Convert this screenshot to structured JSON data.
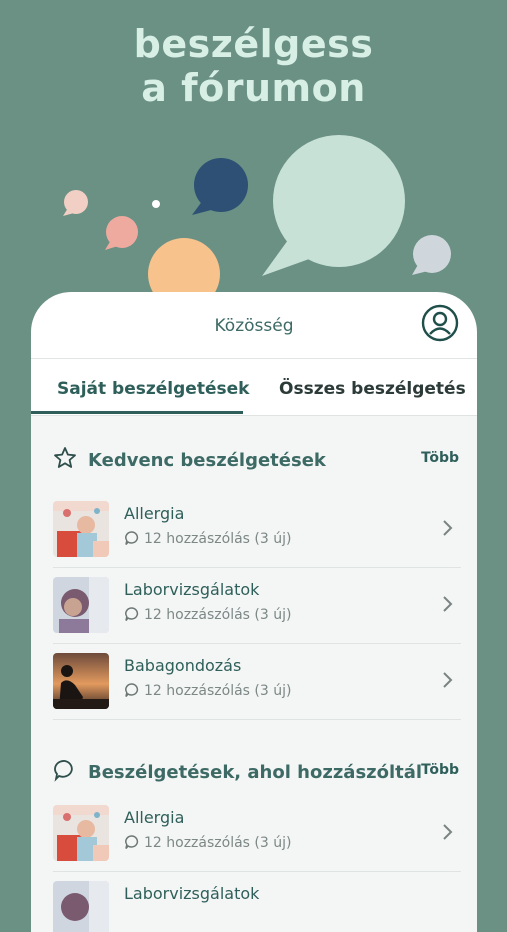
{
  "headline": {
    "line1": "beszélgess",
    "line2": "a fórumon"
  },
  "app": {
    "title": "Közösség"
  },
  "tabs": [
    {
      "label": "Saját beszélgetések",
      "active": true
    },
    {
      "label": "Összes beszélgetés",
      "active": false
    }
  ],
  "sections": [
    {
      "title": "Kedvenc beszélgetések",
      "more": "Több",
      "icon": "star-icon",
      "items": [
        {
          "title": "Allergia",
          "meta": "12 hozzászólás (3 új)"
        },
        {
          "title": "Laborvizsgálatok",
          "meta": "12 hozzászólás (3 új)"
        },
        {
          "title": "Babagondozás",
          "meta": "12 hozzászólás (3 új)"
        }
      ]
    },
    {
      "title": "Beszélgetések, ahol hozzászóltál",
      "more": "Több",
      "icon": "comment-icon",
      "items": [
        {
          "title": "Allergia",
          "meta": "12 hozzászólás (3 új)"
        },
        {
          "title": "Laborvizsgálatok",
          "meta": ""
        }
      ]
    }
  ],
  "colors": {
    "background": "#6a9184",
    "accent": "#2f5f5a",
    "headline": "#d8efe6"
  }
}
